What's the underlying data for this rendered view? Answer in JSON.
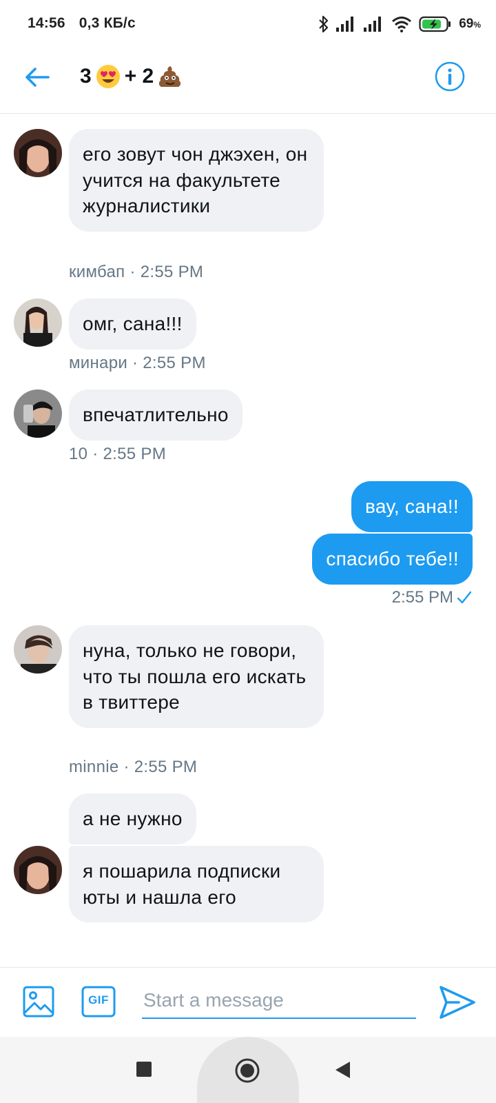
{
  "status": {
    "time": "14:56",
    "speed": "0,3 КБ/с",
    "battery": "69",
    "battery_unit": "%"
  },
  "header": {
    "title_left": "3",
    "title_mid": "+ 2"
  },
  "messages": [
    {
      "text": "его зовут чон джэхен, он учится на факультете журналистики",
      "meta": "кимбап · 2:55 PM"
    },
    {
      "text": "омг, сана!!!",
      "meta": "минари · 2:55 PM"
    },
    {
      "text": "впечатлительно",
      "meta": "10 · 2:55 PM"
    },
    {
      "text": "вау, сана!!"
    },
    {
      "text": "спасибо тебе!!",
      "meta": "2:55 PM"
    },
    {
      "text": "нуна, только не говори, что ты пошла его искать в твиттере",
      "meta": "minnie · 2:55 PM"
    },
    {
      "text": "а не нужно"
    },
    {
      "text": "я пошарила подписки юты и нашла его"
    }
  ],
  "composer": {
    "placeholder": "Start a message",
    "gif_label": "GIF"
  },
  "colors": {
    "accent": "#1d9bf0",
    "bubble_in": "#eff1f4",
    "meta": "#657786"
  }
}
